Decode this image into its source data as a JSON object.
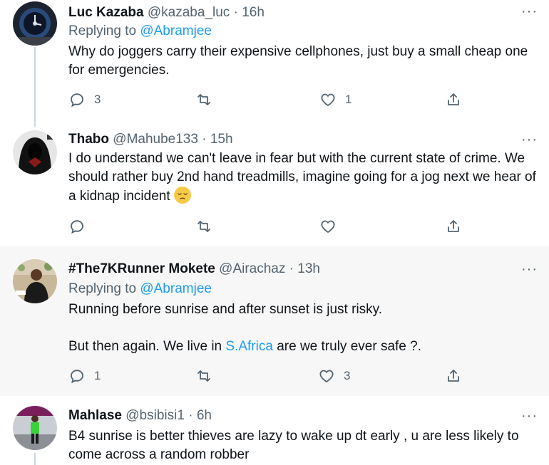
{
  "tweets": [
    {
      "name": "Luc Kazaba",
      "handle": "@kazaba_luc",
      "dot": "·",
      "time": "16h",
      "replying_prefix": "Replying to",
      "replying_to": "@Abramjee",
      "text1": "Why do joggers carry their expensive cellphones, just buy a small cheap one for emergencies.",
      "reply_count": "3",
      "retweet_count": "",
      "like_count": "1"
    },
    {
      "name": "Thabo",
      "handle": "@Mahube133",
      "dot": "·",
      "time": "15h",
      "text1": "I do understand we can't leave in fear but with the current state of crime. We should rather buy 2nd hand treadmills, imagine going for a jog next we hear of a kidnap incident",
      "emoji": "pensive-face",
      "reply_count": "",
      "retweet_count": "",
      "like_count": ""
    },
    {
      "name": "#The7KRunner Mokete",
      "handle": "@Airachaz",
      "dot": "·",
      "time": "13h",
      "replying_prefix": "Replying to",
      "replying_to": "@Abramjee",
      "text1": "Running before sunrise and after sunset is just risky.",
      "text2_before": "But then again. We live in",
      "text2_link": "S.Africa",
      "text2_after": "are we truly ever safe ?.",
      "reply_count": "1",
      "retweet_count": "",
      "like_count": "3"
    },
    {
      "name": "Mahlase",
      "handle": "@bsibisi1",
      "dot": "·",
      "time": "6h",
      "text1": "B4 sunrise is better thieves are lazy to wake up dt early , u are less likely to come across a random robber"
    }
  ],
  "more_label": "···",
  "colors": {
    "link": "#1d9bf0",
    "muted": "#536471",
    "highlight_bg": "#f7f7f7",
    "thread_line": "#cfd9de"
  }
}
